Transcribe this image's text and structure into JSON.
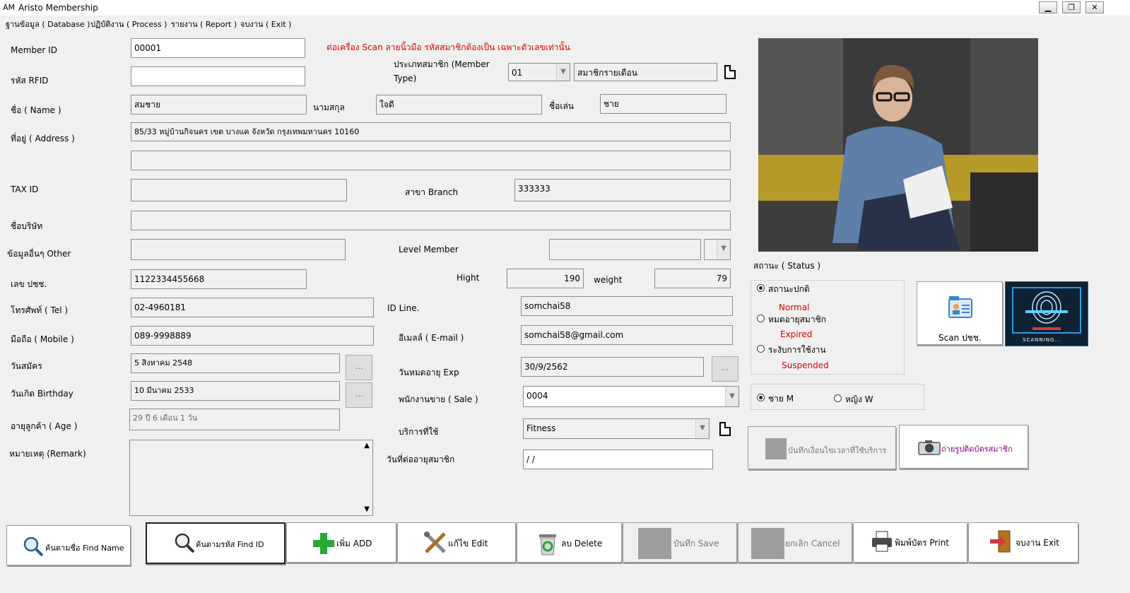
{
  "window": {
    "title": "Aristo Membership",
    "icon_text": "AM",
    "buttons": {
      "minimize": "▁",
      "restore": "❐",
      "close": "✕"
    }
  },
  "menu": [
    "ฐานข้อมูล ( Database )",
    "ปฏิบัติงาน ( Process )",
    "รายงาน ( Report )",
    "จบงาน ( Exit )"
  ],
  "notice": "ต่อเครื่อง Scan ลายนิ้วมือ รหัสสมาชิกต้องเป็น เฉพาะตัวเลขเท่านั้น",
  "form": {
    "member_id": {
      "label": "Member ID",
      "value": "00001"
    },
    "rfid": {
      "label": "รหัส RFID",
      "value": ""
    },
    "member_type": {
      "label_line1": "ประเภทสมาชิก (Member",
      "label_line2": "Type)",
      "code": "01",
      "name": "สมาชิกรายเดือน"
    },
    "name": {
      "label": "ชื่อ ( Name )",
      "value": "สมชาย"
    },
    "surname": {
      "label": "นามสกุล",
      "value": "ใจดี"
    },
    "nickname": {
      "label": "ชื่อเล่น",
      "value": "ชาย"
    },
    "address": {
      "label": "ที่อยู่ ( Address )",
      "line1": "85/33  หมู่บ้านกิจนคร   เขต บางแค  จังหวัด กรุงเทพมหานคร 10160",
      "line2": ""
    },
    "tax_id": {
      "label": "TAX ID",
      "value": ""
    },
    "branch": {
      "label": "สาขา Branch",
      "value": "333333"
    },
    "company": {
      "label": "ชื่อบริษัท",
      "value": ""
    },
    "other": {
      "label": "ข้อมูลอื่นๆ Other",
      "value": ""
    },
    "level": {
      "label": "Level Member",
      "value": "",
      "code": ""
    },
    "citizen_id": {
      "label": "เลข ปชช.",
      "value": "1122334455668"
    },
    "height": {
      "label": "Hight",
      "value": "190"
    },
    "weight": {
      "label": "weight",
      "value": "79"
    },
    "tel": {
      "label": "โทรศัพท์ ( Tel )",
      "value": "02-4960181"
    },
    "id_line": {
      "label": "ID Line.",
      "value": "somchai58"
    },
    "mobile": {
      "label": "มือถือ ( Mobile )",
      "value": "089-9998889"
    },
    "email": {
      "label": "อีเมลล์ ( E-mail )",
      "value": "somchai58@gmail.com"
    },
    "apply_date": {
      "label": "วันสมัคร",
      "value": "5 สิงหาคม 2548"
    },
    "exp_date": {
      "label": "วันหมดอายุ Exp",
      "value": "30/9/2562"
    },
    "birthday": {
      "label": "วันเกิด Birthday",
      "value": "10 มีนาคม 2533"
    },
    "sale": {
      "label": "พนักงานขาย ( Sale )",
      "value": "0004"
    },
    "age": {
      "label": "อายุลูกค้า ( Age )",
      "value": "29 ปี  6 เดือน  1 วัน"
    },
    "service": {
      "label": "บริการที่ใช้",
      "value": "Fitness"
    },
    "remark": {
      "label": "หมายเหตุ (Remark)",
      "value": ""
    },
    "renew_date": {
      "label": "วันที่ต่ออายุสมาชิก",
      "value": " /  /"
    },
    "dots_label": "..."
  },
  "status": {
    "label": "สถานะ ( Status )",
    "options": [
      {
        "label": "สถานะปกติ",
        "sub": "Normal",
        "selected": true
      },
      {
        "label": "หมดอายุสมาชิก",
        "sub": "Expired",
        "selected": false
      },
      {
        "label": "ระงับการใช้งาน",
        "sub": "Suspended",
        "selected": false
      }
    ]
  },
  "gender": {
    "options": [
      {
        "label": "ชาย M",
        "selected": true
      },
      {
        "label": "หญิง W",
        "selected": false
      }
    ]
  },
  "side_buttons": {
    "scan_id": "Scan ปชช.",
    "scanning": "SCANNING...",
    "record_time": "บันทึกเงื่อนไขเวลาที่ใช้บริการ",
    "photo_card": "ถ่ายรูปติดบัตรสมาชิก"
  },
  "toolbar": {
    "find_name": "ค้นตามชื่อ Find Name",
    "find_id": "ค้นตามรหัส Find ID",
    "add": "เพิ่ม ADD",
    "edit": "แก้ไข   Edit",
    "delete": "ลบ   Delete",
    "save": "บันทึก   Save",
    "cancel": "ยกเลิก Cancel",
    "print": "พิมพ์บัตร   Print",
    "exit": "จบงาน   Exit"
  },
  "colors": {
    "notice": "#e00000",
    "status_sub": "#e00000",
    "photo_caption": "#8a0086"
  }
}
